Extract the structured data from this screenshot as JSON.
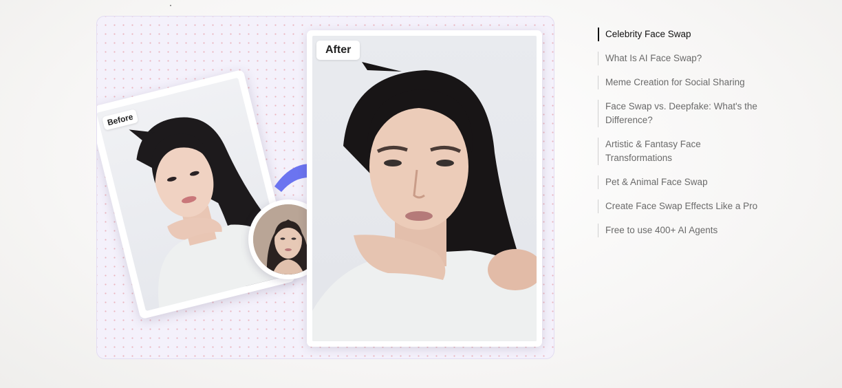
{
  "showcase": {
    "before_label": "Before",
    "after_label": "After",
    "arrow_color": "#6b74f0",
    "dot_color": "#eab5bf",
    "panel_bg": "#f4f1fb"
  },
  "toc": {
    "items": [
      {
        "label": "Celebrity Face Swap",
        "active": true
      },
      {
        "label": "What Is AI Face Swap?",
        "active": false
      },
      {
        "label": "Meme Creation for Social Sharing",
        "active": false
      },
      {
        "label": "Face Swap vs. Deepfake: What's the Difference?",
        "active": false
      },
      {
        "label": "Artistic & Fantasy Face Transformations",
        "active": false
      },
      {
        "label": "Pet & Animal Face Swap",
        "active": false
      },
      {
        "label": "Create Face Swap Effects Like a Pro",
        "active": false
      },
      {
        "label": "Free to use 400+ AI Agents",
        "active": false
      }
    ]
  }
}
